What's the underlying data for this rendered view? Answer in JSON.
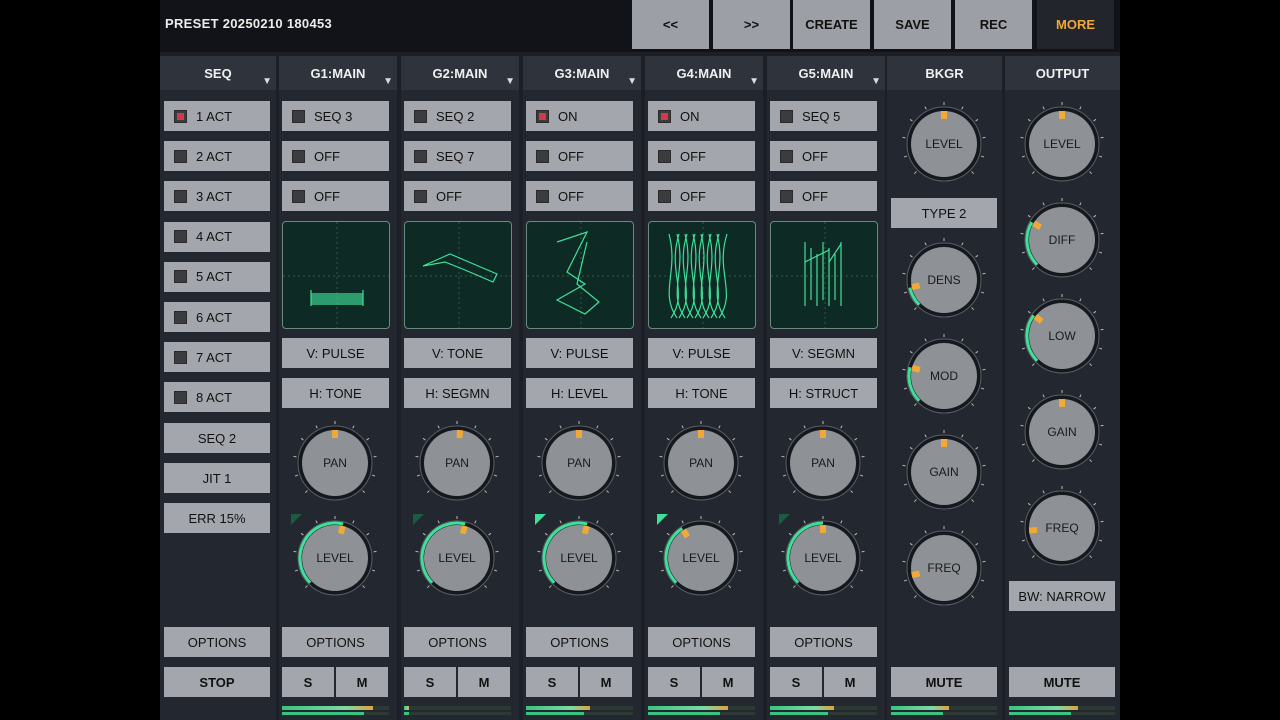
{
  "header": {
    "preset_title": "PRESET 20250210 180453",
    "buttons": {
      "prev": "<<",
      "next": ">>",
      "create": "CREATE",
      "save": "SAVE",
      "rec": "REC",
      "more": "MORE"
    }
  },
  "colors": {
    "accent": "#f0a836",
    "scope_green": "#3fe09a",
    "active_led": "#d23a47",
    "button": "#a3a6ac"
  },
  "seq": {
    "title": "SEQ",
    "acts": [
      {
        "label": "1 ACT",
        "on": true
      },
      {
        "label": "2 ACT",
        "on": false
      },
      {
        "label": "3 ACT",
        "on": false
      },
      {
        "label": "4 ACT",
        "on": false
      },
      {
        "label": "5 ACT",
        "on": false
      },
      {
        "label": "6 ACT",
        "on": false
      },
      {
        "label": "7 ACT",
        "on": false
      },
      {
        "label": "8 ACT",
        "on": false
      }
    ],
    "seq_label": "SEQ 2",
    "jit_label": "JIT 1",
    "err_label": "ERR 15%",
    "options": "OPTIONS",
    "stop": "STOP"
  },
  "groups": [
    {
      "title": "G1:MAIN",
      "rows": [
        {
          "label": "SEQ 3",
          "on": false
        },
        {
          "label": "OFF",
          "on": false
        },
        {
          "label": "OFF",
          "on": false
        }
      ],
      "v": "V: PULSE",
      "h": "H: TONE",
      "pan": "PAN",
      "level": "LEVEL",
      "options": "OPTIONS",
      "s": "S",
      "m": "M",
      "pan_value": 0.5,
      "level_value": 0.55,
      "meter": 0.85
    },
    {
      "title": "G2:MAIN",
      "rows": [
        {
          "label": "SEQ 2",
          "on": false
        },
        {
          "label": "SEQ 7",
          "on": false
        },
        {
          "label": "OFF",
          "on": false
        }
      ],
      "v": "V: TONE",
      "h": "H: SEGMN",
      "pan": "PAN",
      "level": "LEVEL",
      "options": "OPTIONS",
      "s": "S",
      "m": "M",
      "pan_value": 0.52,
      "level_value": 0.55,
      "meter": 0.05
    },
    {
      "title": "G3:MAIN",
      "rows": [
        {
          "label": "ON",
          "on": true
        },
        {
          "label": "OFF",
          "on": false
        },
        {
          "label": "OFF",
          "on": false
        }
      ],
      "v": "V: PULSE",
      "h": "H: LEVEL",
      "pan": "PAN",
      "level": "LEVEL",
      "options": "OPTIONS",
      "s": "S",
      "m": "M",
      "pan_value": 0.5,
      "level_value": 0.55,
      "meter": 0.6
    },
    {
      "title": "G4:MAIN",
      "rows": [
        {
          "label": "ON",
          "on": true
        },
        {
          "label": "OFF",
          "on": false
        },
        {
          "label": "OFF",
          "on": false
        }
      ],
      "v": "V: PULSE",
      "h": "H: TONE",
      "pan": "PAN",
      "level": "LEVEL",
      "options": "OPTIONS",
      "s": "S",
      "m": "M",
      "pan_value": 0.5,
      "level_value": 0.38,
      "meter": 0.75
    },
    {
      "title": "G5:MAIN",
      "rows": [
        {
          "label": "SEQ 5",
          "on": false
        },
        {
          "label": "OFF",
          "on": false
        },
        {
          "label": "OFF",
          "on": false
        }
      ],
      "v": "V: SEGMN",
      "h": "H: STRUCT",
      "pan": "PAN",
      "level": "LEVEL",
      "options": "OPTIONS",
      "s": "S",
      "m": "M",
      "pan_value": 0.5,
      "level_value": 0.5,
      "meter": 0.6
    }
  ],
  "bkgr": {
    "title": "BKGR",
    "level": "LEVEL",
    "type": "TYPE 2",
    "dens": "DENS",
    "mod": "MOD",
    "gain": "GAIN",
    "freq": "FREQ",
    "mute": "MUTE",
    "level_value": 0.5,
    "dens_value": 0.12,
    "mod_value": 0.22,
    "gain_value": 0.5,
    "freq_value": 0.12,
    "meter": 0.55
  },
  "output": {
    "title": "OUTPUT",
    "level": "LEVEL",
    "diff": "DIFF",
    "low": "LOW",
    "gain": "GAIN",
    "freq": "FREQ",
    "bw": "BW: NARROW",
    "mute": "MUTE",
    "level_value": 0.5,
    "diff_value": 0.28,
    "low_value": 0.3,
    "gain_value": 0.5,
    "freq_value": 0.15,
    "meter": 0.65
  }
}
